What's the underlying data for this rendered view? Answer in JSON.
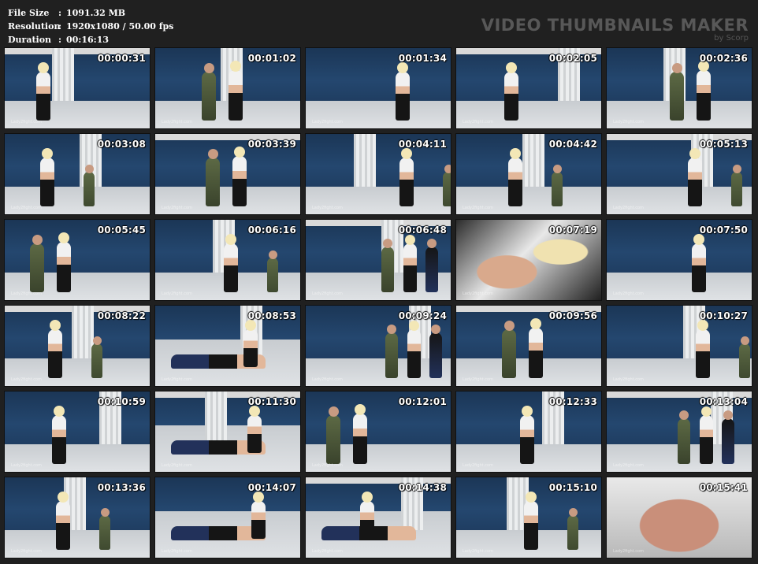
{
  "info": {
    "file_size_label": "File Size",
    "file_size_value": "1091.32 MB",
    "resolution_label": "Resolution",
    "resolution_value": "1920x1080 / 50.00 fps",
    "duration_label": "Duration",
    "duration_value": "00:16:13",
    "colon": ":"
  },
  "brand": {
    "title": "VIDEO THUMBNAILS MAKER",
    "subtitle": "by Scorp"
  },
  "watermark": "Lady2fight.com",
  "thumbnails": [
    {
      "time": "00:00:31",
      "scene": "chair"
    },
    {
      "time": "00:01:02",
      "scene": "pair"
    },
    {
      "time": "00:01:34",
      "scene": "chair"
    },
    {
      "time": "00:02:05",
      "scene": "stand"
    },
    {
      "time": "00:02:36",
      "scene": "lift"
    },
    {
      "time": "00:03:08",
      "scene": "room"
    },
    {
      "time": "00:03:39",
      "scene": "lift"
    },
    {
      "time": "00:04:11",
      "scene": "room"
    },
    {
      "time": "00:04:42",
      "scene": "room"
    },
    {
      "time": "00:05:13",
      "scene": "room"
    },
    {
      "time": "00:05:45",
      "scene": "pair"
    },
    {
      "time": "00:06:16",
      "scene": "room"
    },
    {
      "time": "00:06:48",
      "scene": "group"
    },
    {
      "time": "00:07:19",
      "scene": "closeup"
    },
    {
      "time": "00:07:50",
      "scene": "stand"
    },
    {
      "time": "00:08:22",
      "scene": "room"
    },
    {
      "time": "00:08:53",
      "scene": "floor"
    },
    {
      "time": "00:09:24",
      "scene": "group"
    },
    {
      "time": "00:09:56",
      "scene": "pair"
    },
    {
      "time": "00:10:27",
      "scene": "room"
    },
    {
      "time": "00:10:59",
      "scene": "stand"
    },
    {
      "time": "00:11:30",
      "scene": "floor"
    },
    {
      "time": "00:12:01",
      "scene": "pair"
    },
    {
      "time": "00:12:33",
      "scene": "chair"
    },
    {
      "time": "00:13:04",
      "scene": "group"
    },
    {
      "time": "00:13:36",
      "scene": "room"
    },
    {
      "time": "00:14:07",
      "scene": "floor"
    },
    {
      "time": "00:14:38",
      "scene": "floor"
    },
    {
      "time": "00:15:10",
      "scene": "room"
    },
    {
      "time": "00:15:41",
      "scene": "closeup"
    }
  ]
}
